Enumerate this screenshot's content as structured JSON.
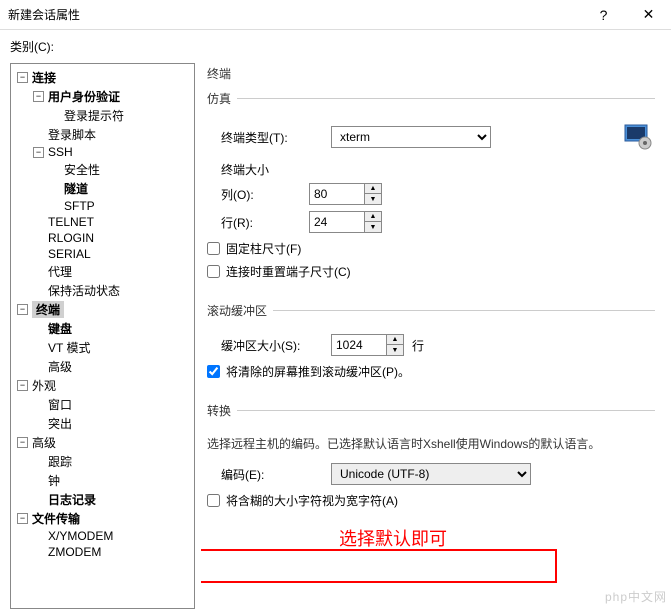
{
  "window": {
    "title": "新建会话属性",
    "help": "?",
    "close": "✕"
  },
  "category_label": "类别(C):",
  "tree": {
    "connection": "连接",
    "auth": "用户身份验证",
    "login_prompt": "登录提示符",
    "login_script": "登录脚本",
    "ssh": "SSH",
    "security": "安全性",
    "tunnel": "隧道",
    "sftp": "SFTP",
    "telnet": "TELNET",
    "rlogin": "RLOGIN",
    "serial": "SERIAL",
    "proxy": "代理",
    "keepalive": "保持活动状态",
    "terminal": "终端",
    "keyboard": "键盘",
    "vtmode": "VT 模式",
    "advanced": "高级",
    "appearance": "外观",
    "window": "窗口",
    "highlight": "突出",
    "adv": "高级",
    "trace": "跟踪",
    "bell": "钟",
    "logging": "日志记录",
    "filetransfer": "文件传输",
    "xymodem": "X/YMODEM",
    "zmodem": "ZMODEM"
  },
  "panel": {
    "title": "终端",
    "emulation": {
      "legend": "仿真",
      "type_label": "终端类型(T):",
      "type_value": "xterm",
      "size_label": "终端大小",
      "cols_label": "列(O):",
      "cols_value": "80",
      "rows_label": "行(R):",
      "rows_value": "24",
      "fixed_cols": "固定柱尺寸(F)",
      "reset_on_connect": "连接时重置端子尺寸(C)"
    },
    "scroll": {
      "legend": "滚动缓冲区",
      "size_label": "缓冲区大小(S):",
      "size_value": "1024",
      "unit": "行",
      "push_clear": "将清除的屏幕推到滚动缓冲区(P)。"
    },
    "translate": {
      "legend": "转换",
      "desc": "选择远程主机的编码。已选择默认语言时Xshell使用Windows的默认语言。",
      "annotation": "选择默认即可",
      "encoding_label": "编码(E):",
      "encoding_value": "Unicode (UTF-8)",
      "ambiguous_wide": "将含糊的大小字符视为宽字符(A)"
    }
  },
  "watermark": "php中文网"
}
